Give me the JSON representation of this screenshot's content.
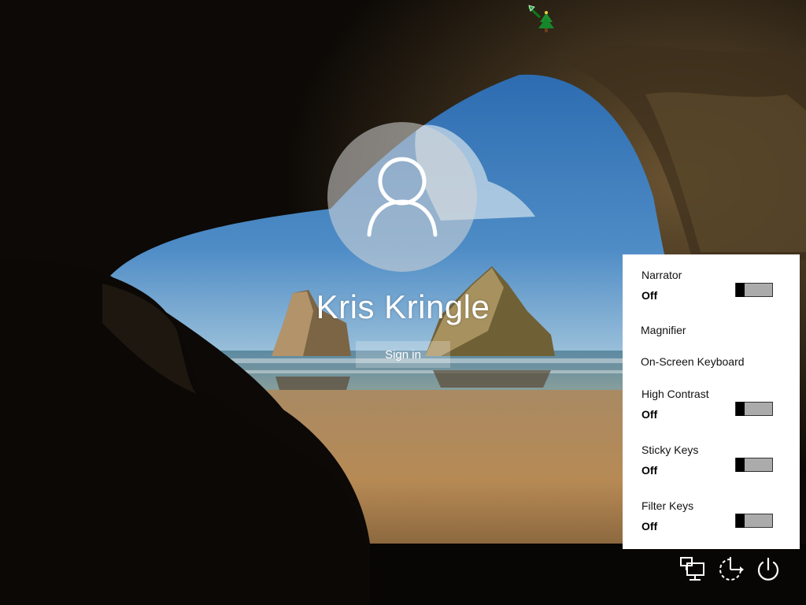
{
  "user": {
    "name": "Kris Kringle",
    "sign_in_label": "Sign in"
  },
  "ease_of_access": {
    "toggles": [
      {
        "label": "Narrator",
        "state": "Off"
      },
      {
        "label": "High Contrast",
        "state": "Off"
      },
      {
        "label": "Sticky Keys",
        "state": "Off"
      },
      {
        "label": "Filter Keys",
        "state": "Off"
      }
    ],
    "links": [
      {
        "label": "Magnifier"
      },
      {
        "label": "On-Screen Keyboard"
      }
    ]
  },
  "tray": {
    "icons": [
      "network-icon",
      "ease-of-access-icon",
      "power-icon"
    ]
  },
  "colors": {
    "sky": "#2f6fb2",
    "sand": "#b58a52",
    "cave": "#0d0a07",
    "panel": "#ffffff",
    "toggle_track": "#ababab"
  }
}
